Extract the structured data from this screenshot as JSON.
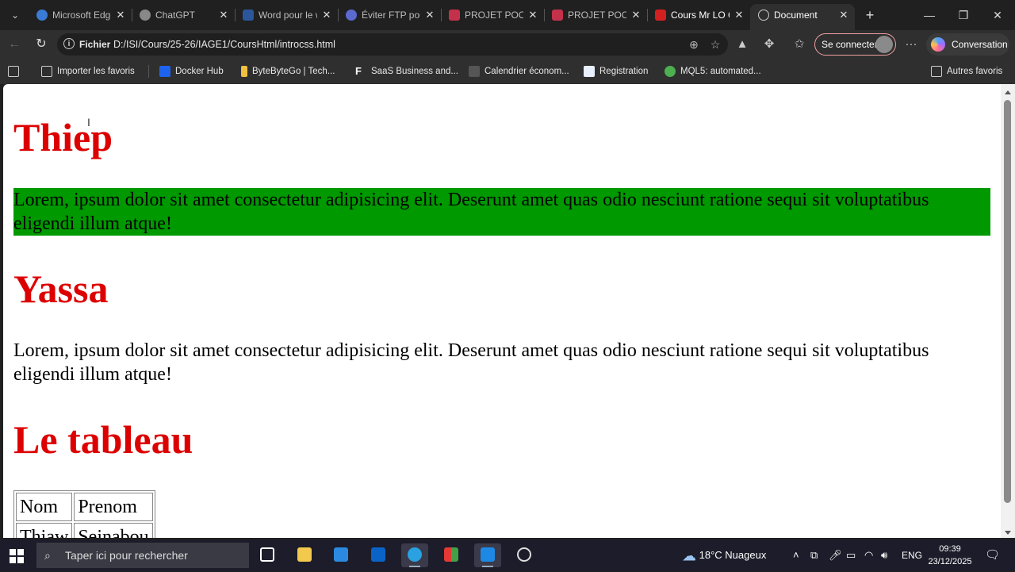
{
  "tabs": [
    {
      "label": "Microsoft Edge",
      "color": "#3a7bd5"
    },
    {
      "label": "ChatGPT",
      "color": "#888888"
    },
    {
      "label": "Word pour le web",
      "color": "#2b579a"
    },
    {
      "label": "Éviter FTP pour",
      "color": "#5a6acf"
    },
    {
      "label": "PROJET POO tp",
      "color": "#c4314b"
    },
    {
      "label": "PROJET POO tp",
      "color": "#c4314b"
    },
    {
      "label": "Cours Mr LO C",
      "color": "#d22020"
    },
    {
      "label": "Document",
      "color": "#cccccc"
    }
  ],
  "address": {
    "scheme": "Fichier",
    "url": "D:/ISI/Cours/25-26/IAGE1/CoursHtml/introcss.html"
  },
  "profile": {
    "signin_label": "Se connecter"
  },
  "copilot": {
    "label": "Conversation"
  },
  "bookmarks": {
    "import": "Importer les favoris",
    "items": [
      {
        "label": "Docker Hub",
        "color": "#1d63ed"
      },
      {
        "label": "ByteByteGo | Tech...",
        "color": "#f0c040"
      },
      {
        "label": "SaaS Business and...",
        "color": "#ffffff"
      },
      {
        "label": "Calendrier économ...",
        "color": "#555555"
      },
      {
        "label": "Registration",
        "color": "#e8f0ff"
      },
      {
        "label": "MQL5: automated...",
        "color": "#4caf50"
      }
    ],
    "other": "Autres favoris"
  },
  "page": {
    "heading1": "Thiep",
    "para1": "Lorem, ipsum dolor sit amet consectetur adipisicing elit. Deserunt amet quas odio nesciunt ratione sequi sit voluptatibus eligendi illum atque!",
    "heading2": "Yassa",
    "para2": "Lorem, ipsum dolor sit amet consectetur adipisicing elit. Deserunt amet quas odio nesciunt ratione sequi sit voluptatibus eligendi illum atque!",
    "heading3": "Le tableau",
    "table": {
      "headers": [
        "Nom",
        "Prenom"
      ],
      "rows": [
        [
          "Thiaw",
          "Seinabou"
        ]
      ]
    },
    "heading_color": "#dd0000",
    "highlight_color": "#009900"
  },
  "taskbar": {
    "search_placeholder": "Taper ici pour rechercher",
    "weather": "18°C  Nuageux",
    "lang": "ENG",
    "time": "09:39",
    "date": "23/12/2025"
  }
}
